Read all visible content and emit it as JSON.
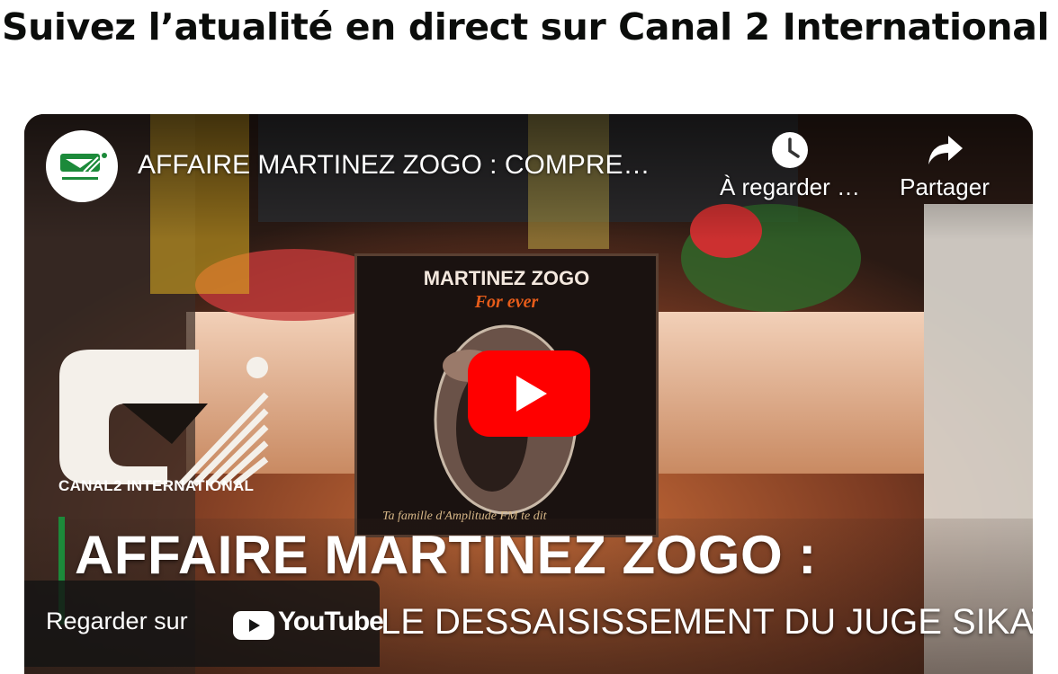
{
  "page": {
    "heading": "Suivez l’atualité en direct sur Canal 2 International"
  },
  "player": {
    "title": "AFFAIRE MARTINEZ ZOGO : COMPRE…",
    "watch_later_label": "À regarder …",
    "share_label": "Partager",
    "watch_on_label": "Regarder sur",
    "youtube_word": "YouTube",
    "icons": {
      "watch_later": "clock-icon",
      "share": "share-arrow-icon",
      "play": "play-icon",
      "youtube": "youtube-logo-icon"
    },
    "colors": {
      "play_button": "#ff0000",
      "brand_green": "#1c8a3a"
    }
  },
  "thumbnail": {
    "brand_text": "CANAL2 INTERNATIONAL",
    "frame_title": "MARTINEZ ZOGO",
    "frame_subtitle": "For ever",
    "frame_caption": "Ta famille d'Amplitude FM te dit",
    "headline_line1": "AFFAIRE MARTINEZ ZOGO :",
    "headline_line2": "LE DESSAISISSEMENT DU JUGE SIKATI"
  }
}
